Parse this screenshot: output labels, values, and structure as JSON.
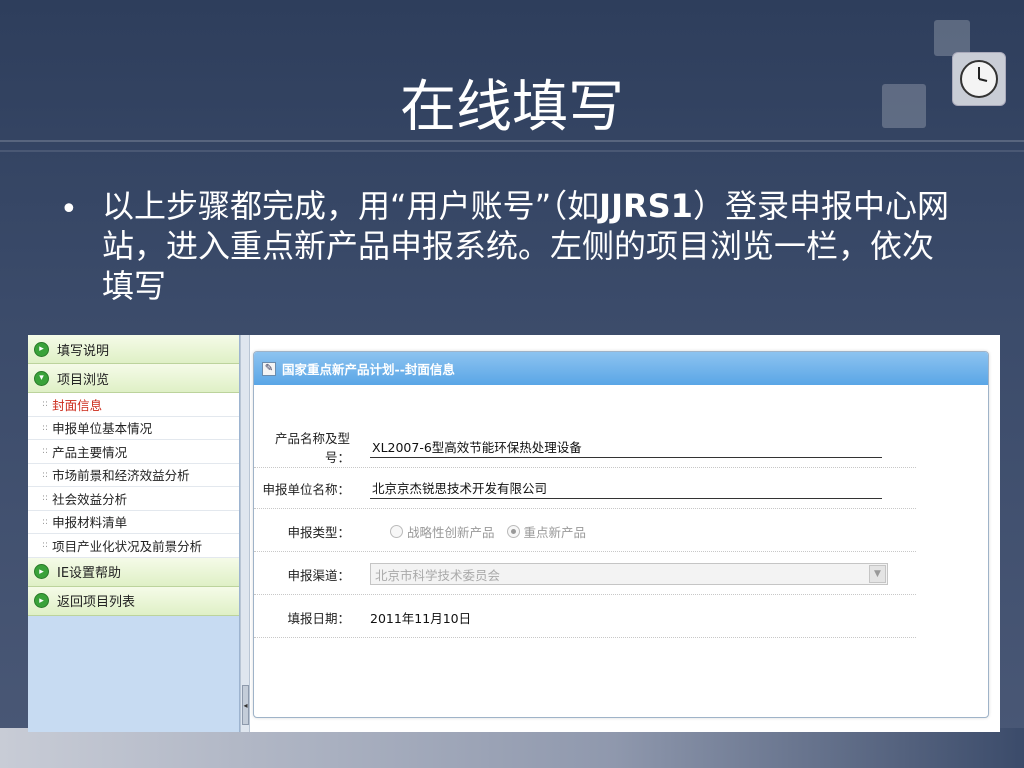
{
  "slide": {
    "title": "在线填写",
    "bullet_pre": "以上步骤都完成，用“用户账号”（如",
    "bullet_bold": "JJRS1",
    "bullet_post": "）登录申报中心网站，进入重点新产品申报系统。左侧的项目浏览一栏，依次填写"
  },
  "sidebar": {
    "head1": "填写说明",
    "head2": "项目浏览",
    "items": [
      "封面信息",
      "申报单位基本情况",
      "产品主要情况",
      "市场前景和经济效益分析",
      "社会效益分析",
      "申报材料清单",
      "项目产业化状况及前景分析"
    ],
    "head3": "IE设置帮助",
    "head4": "返回项目列表"
  },
  "panel": {
    "title": "国家重点新产品计划--封面信息",
    "fields": {
      "product_label": "产品名称及型号：",
      "product_value": "XL2007-6型高效节能环保热处理设备",
      "unit_label": "申报单位名称：",
      "unit_value": "北京京杰锐思技术开发有限公司",
      "type_label": "申报类型：",
      "type_option1": "战略性创新产品",
      "type_option2": "重点新产品",
      "channel_label": "申报渠道：",
      "channel_value": "北京市科学技术委员会",
      "date_label": "填报日期：",
      "date_value": "2011年11月10日"
    }
  },
  "colors": {
    "accent_header": "#5aa6e6",
    "active_item": "#cc2a1a",
    "nav_green": "#3aa23a"
  }
}
